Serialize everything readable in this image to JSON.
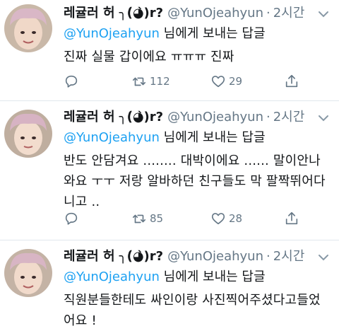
{
  "tweets": [
    {
      "display_name": "레귤러 허 ╮(́◕̀)r?",
      "handle": "@YunOjeahyun",
      "separator": "·",
      "time": "2시간",
      "reply_to_handle": "@YunOjeahyun",
      "reply_to_suffix": " 님에게 보내는 답글",
      "text": "진짜 실물 갑이에요 ㅠㅠㅠ 진짜",
      "replies": "",
      "retweets": "112",
      "likes": "29"
    },
    {
      "display_name": "레귤러 허 ╮(́◕̀)r?",
      "handle": "@YunOjeahyun",
      "separator": "·",
      "time": "2시간",
      "reply_to_handle": "@YunOjeahyun",
      "reply_to_suffix": " 님에게 보내는 답글",
      "text": "반도 안담겨요 ........ 대박이에요 ...... 말이안나와요 ㅜㅜ 저랑 알바하던 친구들도 막 팔짝뛰어다니고 ..",
      "replies": "",
      "retweets": "85",
      "likes": "28"
    },
    {
      "display_name": "레귤러 허 ╮(́◕̀)r?",
      "handle": "@YunOjeahyun",
      "separator": "·",
      "time": "2시간",
      "reply_to_handle": "@YunOjeahyun",
      "reply_to_suffix": " 님에게 보내는 답글",
      "text": "직원분들한테도 싸인이랑 사진찍어주셨다고들었어요 !"
    }
  ],
  "icons": {
    "reply": "reply-icon",
    "retweet": "retweet-icon",
    "like": "heart-icon",
    "share": "share-icon",
    "more": "chevron-down-icon"
  },
  "colors": {
    "text": "#14171a",
    "secondary": "#657786",
    "link": "#1da1f2",
    "divider": "#e1e8ed"
  }
}
